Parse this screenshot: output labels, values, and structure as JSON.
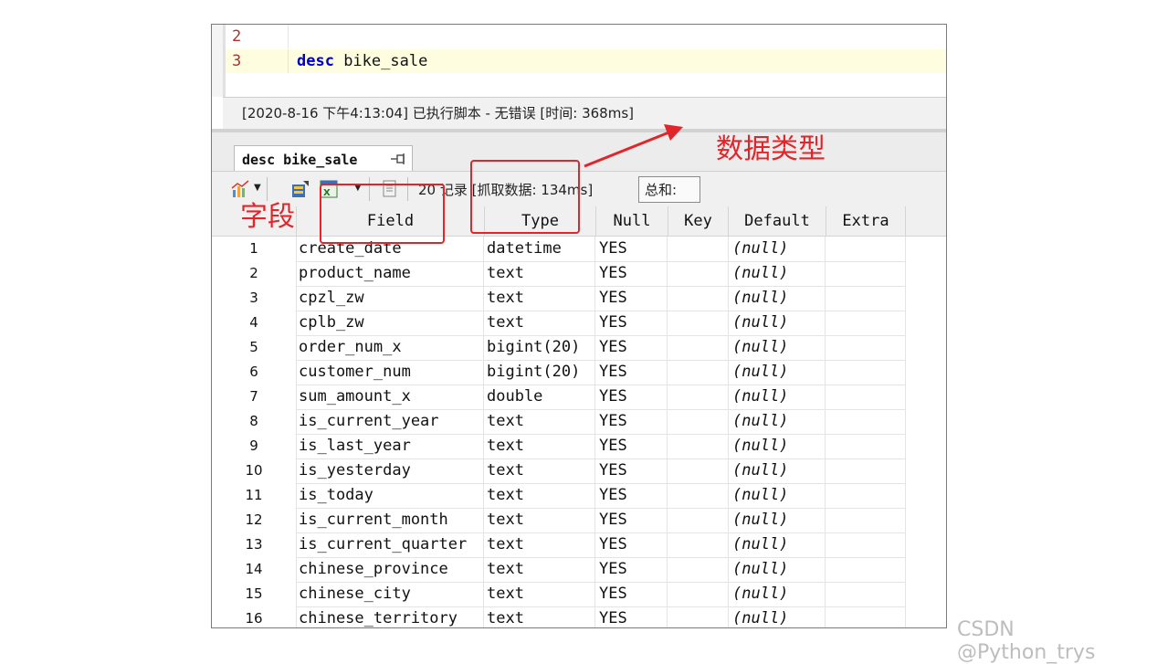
{
  "editor": {
    "lines": [
      {
        "number": "2",
        "code": ""
      },
      {
        "number": "3",
        "keyword": "desc",
        "rest": " bike_sale"
      }
    ]
  },
  "status": {
    "message": "[2020-8-16 下午4:13:04] 已执行脚本 - 无错误  [时间: 368ms]"
  },
  "result_tab": {
    "label": "desc bike_sale",
    "pin_icon": "pin-icon"
  },
  "toolbar": {
    "icons": [
      "chart-icon",
      "export-icon",
      "excel-icon",
      "copy-icon"
    ],
    "records_text": "20 记录 [抓取数据: 134ms]",
    "sum_label": "总和:"
  },
  "grid": {
    "columns": [
      "Field",
      "Type",
      "Null",
      "Key",
      "Default",
      "Extra"
    ],
    "rows": [
      {
        "n": "1",
        "field": "create_date",
        "type": "datetime",
        "null": "YES",
        "key": "",
        "default": "(null)",
        "extra": ""
      },
      {
        "n": "2",
        "field": "product_name",
        "type": "text",
        "null": "YES",
        "key": "",
        "default": "(null)",
        "extra": ""
      },
      {
        "n": "3",
        "field": "cpzl_zw",
        "type": "text",
        "null": "YES",
        "key": "",
        "default": "(null)",
        "extra": ""
      },
      {
        "n": "4",
        "field": "cplb_zw",
        "type": "text",
        "null": "YES",
        "key": "",
        "default": "(null)",
        "extra": ""
      },
      {
        "n": "5",
        "field": "order_num_x",
        "type": "bigint(20)",
        "null": "YES",
        "key": "",
        "default": "(null)",
        "extra": ""
      },
      {
        "n": "6",
        "field": "customer_num",
        "type": "bigint(20)",
        "null": "YES",
        "key": "",
        "default": "(null)",
        "extra": ""
      },
      {
        "n": "7",
        "field": "sum_amount_x",
        "type": "double",
        "null": "YES",
        "key": "",
        "default": "(null)",
        "extra": ""
      },
      {
        "n": "8",
        "field": "is_current_year",
        "type": "text",
        "null": "YES",
        "key": "",
        "default": "(null)",
        "extra": ""
      },
      {
        "n": "9",
        "field": "is_last_year",
        "type": "text",
        "null": "YES",
        "key": "",
        "default": "(null)",
        "extra": ""
      },
      {
        "n": "10",
        "field": "is_yesterday",
        "type": "text",
        "null": "YES",
        "key": "",
        "default": "(null)",
        "extra": ""
      },
      {
        "n": "11",
        "field": "is_today",
        "type": "text",
        "null": "YES",
        "key": "",
        "default": "(null)",
        "extra": ""
      },
      {
        "n": "12",
        "field": "is_current_month",
        "type": "text",
        "null": "YES",
        "key": "",
        "default": "(null)",
        "extra": ""
      },
      {
        "n": "13",
        "field": "is_current_quarter",
        "type": "text",
        "null": "YES",
        "key": "",
        "default": "(null)",
        "extra": ""
      },
      {
        "n": "14",
        "field": "chinese_province",
        "type": "text",
        "null": "YES",
        "key": "",
        "default": "(null)",
        "extra": ""
      },
      {
        "n": "15",
        "field": "chinese_city",
        "type": "text",
        "null": "YES",
        "key": "",
        "default": "(null)",
        "extra": ""
      },
      {
        "n": "16",
        "field": "chinese_territory",
        "type": "text",
        "null": "YES",
        "key": "",
        "default": "(null)",
        "extra": ""
      }
    ]
  },
  "annotations": {
    "field_label": "字段",
    "type_label": "数据类型",
    "color": "#e0262b"
  },
  "watermark": "CSDN @Python_trys"
}
